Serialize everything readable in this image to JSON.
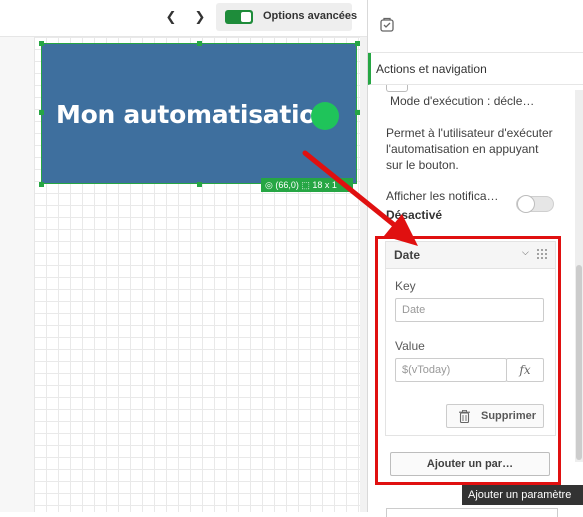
{
  "toolbar": {
    "prev_icon": "chevron-left-icon",
    "next_icon": "chevron-right-icon",
    "advanced_label": "Options avancées",
    "advanced_on": true
  },
  "canvas": {
    "button_label": "Mon automatisation",
    "button_color": "#3e6f9e",
    "dot_color": "#1fc45a",
    "position_badge": "◎ (66,0)  ⬚ 18 x 1"
  },
  "panel": {
    "object_icon": "object-icon",
    "section_title": "Actions et navigation",
    "mode_text": "Mode d'exécution : décle…",
    "description_lines": [
      "Permet à l'utilisateur d'exécuter",
      "l'automatisation en appuyant",
      "sur le bouton."
    ],
    "notif_label": "Afficher les notifica…",
    "notif_state": "Désactivé",
    "param": {
      "title": "Date",
      "key_label": "Key",
      "key_placeholder": "Date",
      "value_label": "Value",
      "value_placeholder": "$(vToday)",
      "fx_label": "fx",
      "delete_label": "Supprimer"
    },
    "add_param_label": "Ajouter un par…"
  },
  "tooltip": "Ajouter un paramètre",
  "colors": {
    "accent_green": "#26a644",
    "highlight_red": "#e01010"
  }
}
